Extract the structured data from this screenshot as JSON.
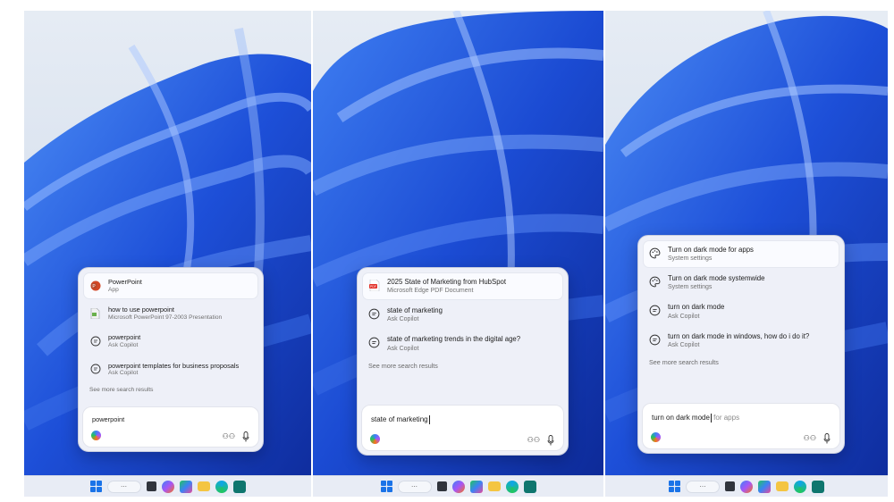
{
  "panels": [
    {
      "results": [
        {
          "title": "PowerPoint",
          "subtitle": "App",
          "icon": "powerpoint-app-icon"
        },
        {
          "title": "how to use powerpoint",
          "subtitle": "Microsoft PowerPoint 97-2003 Presentation",
          "icon": "ppt-file-icon"
        },
        {
          "title": "powerpoint",
          "subtitle": "Ask Copilot",
          "icon": "chat-bubble-icon"
        },
        {
          "title": "powerpoint templates for business proposals",
          "subtitle": "Ask Copilot",
          "icon": "chat-bubble-icon"
        }
      ],
      "see_more": "See more search results",
      "query": "powerpoint",
      "ghost": ""
    },
    {
      "results": [
        {
          "title": "2025 State of Marketing from HubSpot",
          "subtitle": "Microsoft Edge PDF Document",
          "icon": "pdf-file-icon"
        },
        {
          "title": "state of marketing",
          "subtitle": "Ask Copilot",
          "icon": "chat-bubble-icon"
        },
        {
          "title": "state of marketing trends in the digital age?",
          "subtitle": "Ask Copilot",
          "icon": "chat-bubble-icon"
        }
      ],
      "see_more": "See more search results",
      "query": "state of marketing",
      "ghost": ""
    },
    {
      "results": [
        {
          "title": "Turn on dark mode for apps",
          "subtitle": "System settings",
          "icon": "palette-icon"
        },
        {
          "title": "Turn on dark mode systemwide",
          "subtitle": "System settings",
          "icon": "palette-icon"
        },
        {
          "title": "turn on dark mode",
          "subtitle": "Ask Copilot",
          "icon": "chat-bubble-icon"
        },
        {
          "title": "turn on dark mode in windows, how do i do it?",
          "subtitle": "Ask Copilot",
          "icon": "chat-bubble-icon"
        }
      ],
      "see_more": "See more search results",
      "query": "turn on dark mode",
      "ghost": " for apps"
    }
  ],
  "taskbar": {
    "search_label": "⋯",
    "icons": [
      "start-icon",
      "search-pill",
      "task-view-icon",
      "copilot-icon",
      "store-icon",
      "file-explorer-icon",
      "edge-icon",
      "calendar-icon"
    ]
  },
  "colors": {
    "wallpaper_blue": "#1f5fe0",
    "wallpaper_sky": "#dde6f2",
    "accent": "#1a73e8",
    "flyout_bg": "#eef0f8"
  }
}
